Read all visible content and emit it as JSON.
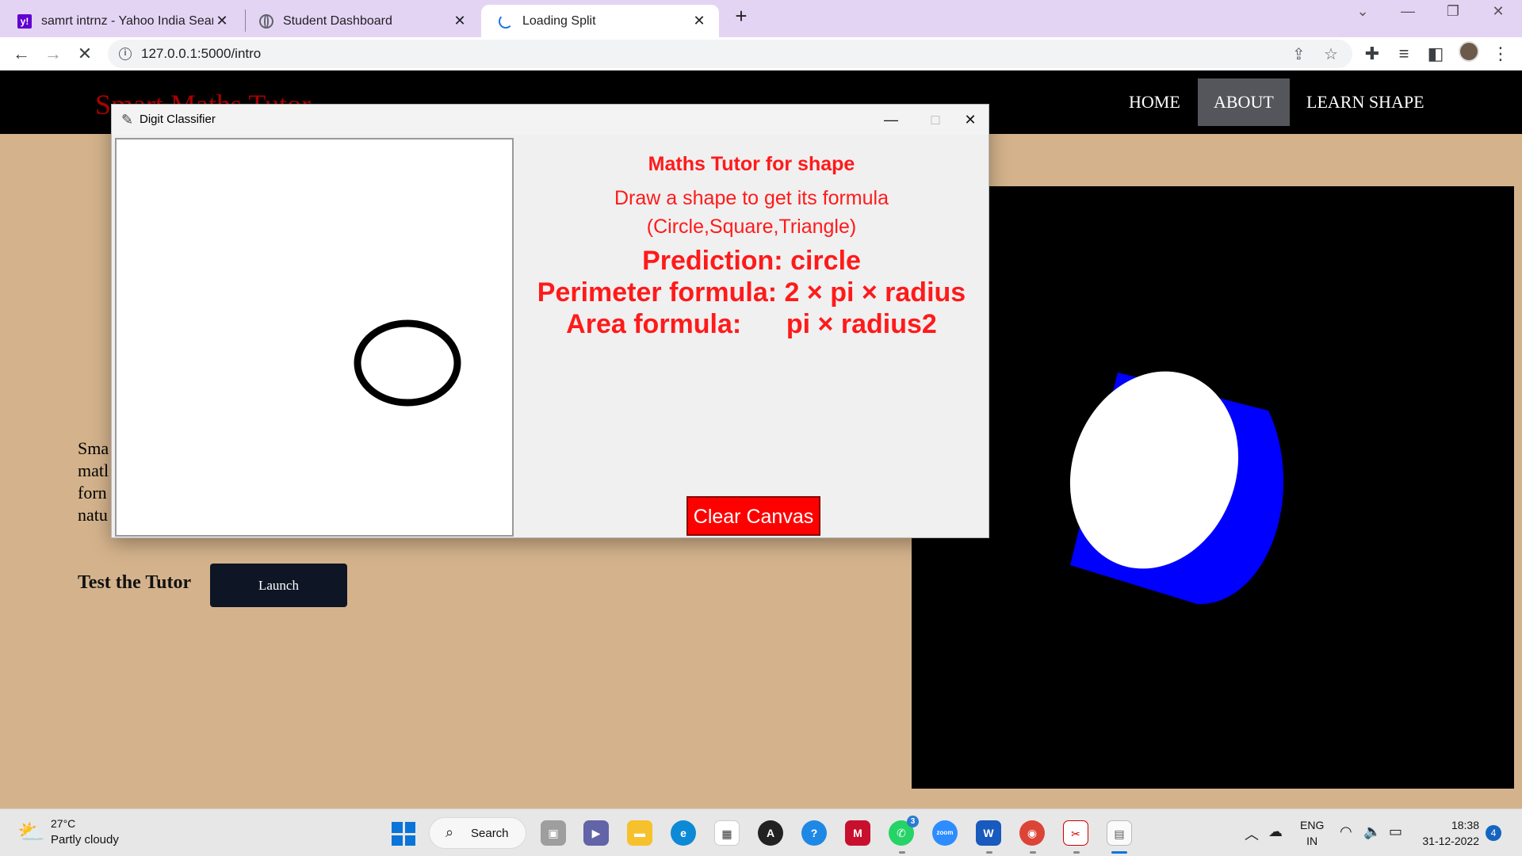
{
  "browser": {
    "tabs": [
      {
        "title": "samrt intrnz - Yahoo India Search",
        "favicon": "yahoo-icon"
      },
      {
        "title": "Student Dashboard",
        "favicon": "globe-icon"
      },
      {
        "title": "Loading Split",
        "favicon": "spinner-icon",
        "active": true
      }
    ],
    "url": "127.0.0.1:5000/intro"
  },
  "site": {
    "logo": "Smart Maths Tutor",
    "nav": [
      {
        "label": "HOME"
      },
      {
        "label": "ABOUT",
        "active": true
      },
      {
        "label": "LEARN SHAPE"
      }
    ],
    "text_lines": [
      "Sma",
      "matl",
      "forn",
      "natu"
    ],
    "test_label": "Test the Tutor",
    "launch_label": "Launch"
  },
  "dialog": {
    "title": "Digit Classifier",
    "heading": "Maths Tutor for shape",
    "instruction_line1": "Draw a shape to get its formula",
    "instruction_line2": "(Circle,Square,Triangle)",
    "prediction": "Prediction: circle",
    "perimeter": "Perimeter formula: 2 × pi × radius",
    "area": "Area formula:      pi × radius2",
    "clear_label": "Clear Canvas"
  },
  "colors": {
    "page_bg": "#d4b38c",
    "dialog_text": "#ff1a1a",
    "clear_button": "#ff0000",
    "cylinder_side": "#0000ff",
    "cylinder_face": "#ffffff"
  },
  "taskbar": {
    "temperature": "27°C",
    "condition": "Partly cloudy",
    "search_label": "Search",
    "lang_top": "ENG",
    "lang_bottom": "IN",
    "time": "18:38",
    "date": "31-12-2022",
    "notifications": "4",
    "whatsapp_badge": "3"
  }
}
